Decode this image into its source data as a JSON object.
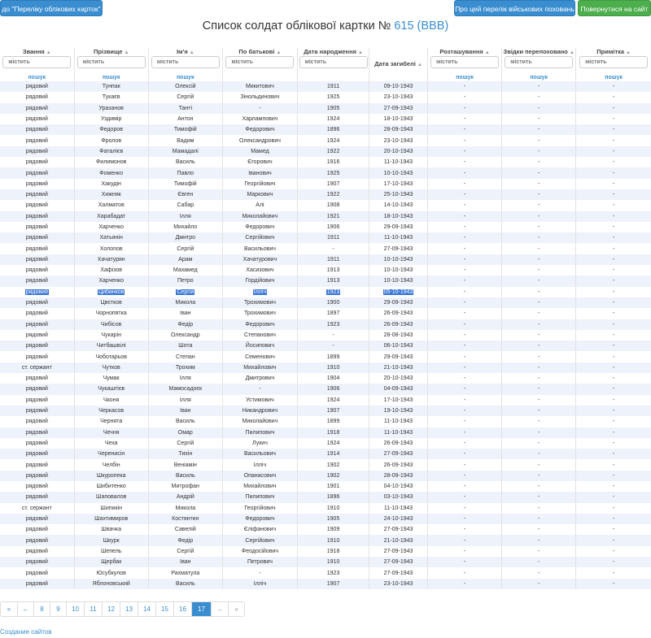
{
  "buttons": {
    "list": "до \"Переліку облікових карток\"",
    "about": "Про цей перелік військових поховань",
    "back": "Повернутися на сайт"
  },
  "title": {
    "text": "Список солдат облікової картки №",
    "number": "615 (ВВВ)"
  },
  "columns": [
    "Звання",
    "Прізвище",
    "Ім'я",
    "По батькові",
    "Дата народження",
    "Дата загибелі",
    "Розташування",
    "Звідки перепоховано",
    "Примітка"
  ],
  "filter_placeholder": "містить",
  "search_label": "пошук",
  "sort_icon": "sort-triangle-icon",
  "rows": [
    [
      "рядовий",
      "Тунпак",
      "Олексій",
      "Микитович",
      "1911",
      "09-10-1943",
      "-",
      "-",
      "-"
    ],
    [
      "рядовий",
      "Тукаєв",
      "Сергій",
      "Зінольдинович",
      "1925",
      "23-10-1943",
      "-",
      "-",
      "-"
    ],
    [
      "рядовий",
      "Уразанов",
      "Танті",
      "-",
      "1905",
      "27-09-1943",
      "-",
      "-",
      "-"
    ],
    [
      "рядовий",
      "Уздимір",
      "Антон",
      "Харлампович",
      "1924",
      "18-10-1943",
      "-",
      "-",
      "-"
    ],
    [
      "рядовий",
      "Федоров",
      "Тимофій",
      "Федорович",
      "1896",
      "28-09-1943",
      "-",
      "-",
      "-"
    ],
    [
      "рядовий",
      "Фролов",
      "Вадим",
      "Олександрович",
      "1924",
      "23-10-1943",
      "-",
      "-",
      "-"
    ],
    [
      "рядовий",
      "Фаталієв",
      "Мамадалі",
      "Мамед",
      "1922",
      "20-10-1943",
      "-",
      "-",
      "-"
    ],
    [
      "рядовий",
      "Филимонов",
      "Василь",
      "Єгорович",
      "1916",
      "11-10-1943",
      "-",
      "-",
      "-"
    ],
    [
      "рядовий",
      "Фоменко",
      "Павло",
      "Іванович",
      "1925",
      "10-10-1943",
      "-",
      "-",
      "-"
    ],
    [
      "рядовий",
      "Хакудін",
      "Тимофій",
      "Георгійович",
      "1907",
      "17-10-1943",
      "-",
      "-",
      "-"
    ],
    [
      "рядовий",
      "Хижняк",
      "Євген",
      "Маркович",
      "1922",
      "25-10-1943",
      "-",
      "-",
      "-"
    ],
    [
      "рядовий",
      "Халматов",
      "Сабар",
      "Алі",
      "1908",
      "14-10-1943",
      "-",
      "-",
      "-"
    ],
    [
      "рядовий",
      "Харабадат",
      "Ілля",
      "Миколайович",
      "1921",
      "18-10-1943",
      "-",
      "-",
      "-"
    ],
    [
      "рядовий",
      "Харченко",
      "Михайло",
      "Федорович",
      "1906",
      "29-09-1943",
      "-",
      "-",
      "-"
    ],
    [
      "рядовий",
      "Хатьянін",
      "Дмитро",
      "Сергійович",
      "1911",
      "11-10-1943",
      "-",
      "-",
      "-"
    ],
    [
      "рядовий",
      "Холопов",
      "Сергій",
      "Васильович",
      "-",
      "27-09-1943",
      "-",
      "-",
      "-"
    ],
    [
      "рядовий",
      "Хачатурян",
      "Арам",
      "Хачатурович",
      "1911",
      "10-10-1943",
      "-",
      "-",
      "-"
    ],
    [
      "рядовий",
      "Хафізов",
      "Махамед",
      "Хасизович",
      "1913",
      "10-10-1943",
      "-",
      "-",
      "-"
    ],
    [
      "рядовий",
      "Харченко",
      "Петро",
      "Гордійович",
      "1913",
      "10-10-1943",
      "-",
      "-",
      "-"
    ],
    [
      "рядовий",
      "Цибанков",
      "Сергій",
      "Ілліч",
      "1923",
      "05-10-1943",
      "-",
      "-",
      "-"
    ],
    [
      "рядовий",
      "Цвєтков",
      "Микола",
      "Трохимович",
      "1900",
      "29-09-1943",
      "-",
      "-",
      "-"
    ],
    [
      "рядовий",
      "Чорнопятка",
      "Іван",
      "Трохимович",
      "1897",
      "26-09-1943",
      "-",
      "-",
      "-"
    ],
    [
      "рядовий",
      "Чибісов",
      "Федір",
      "Федорович",
      "1923",
      "26-09-1943",
      "-",
      "-",
      "-"
    ],
    [
      "рядовий",
      "Чукарін",
      "Олександр",
      "Степанович",
      "-",
      "28-08-1943",
      "-",
      "-",
      "-"
    ],
    [
      "рядовий",
      "Читбашвілі",
      "Шота",
      "Йосипович",
      "-",
      "06-10-1943",
      "-",
      "-",
      "-"
    ],
    [
      "рядовий",
      "Чоботарьов",
      "Степан",
      "Семенович",
      "1899",
      "29-09-1943",
      "-",
      "-",
      "-"
    ],
    [
      "ст. сержант",
      "Чутков",
      "Трохим",
      "Михайлович",
      "1910",
      "21-10-1943",
      "-",
      "-",
      "-"
    ],
    [
      "рядовий",
      "Чумак",
      "Ілля",
      "Дмитрович",
      "1904",
      "20-10-1943",
      "-",
      "-",
      "-"
    ],
    [
      "рядовий",
      "Чукаштієв",
      "Мамосадоєк",
      "-",
      "1906",
      "04-09-1943",
      "-",
      "-",
      "-"
    ],
    [
      "рядовий",
      "Чконя",
      "Ілля",
      "Устимович",
      "1924",
      "17-10-1943",
      "-",
      "-",
      "-"
    ],
    [
      "рядовий",
      "Черкасов",
      "Іван",
      "Никандрович",
      "1907",
      "19-10-1943",
      "-",
      "-",
      "-"
    ],
    [
      "рядовий",
      "Чернята",
      "Василь",
      "Миколайович",
      "1899",
      "11-10-1943",
      "-",
      "-",
      "-"
    ],
    [
      "рядовий",
      "Чечня",
      "Омар",
      "Пилипович",
      "1918",
      "11-10-1943",
      "-",
      "-",
      "-"
    ],
    [
      "рядовий",
      "Чеха",
      "Сергій",
      "Лукич",
      "1924",
      "26-09-1943",
      "-",
      "-",
      "-"
    ],
    [
      "рядовий",
      "Черенисін",
      "Тихін",
      "Васильович",
      "1914",
      "27-09-1943",
      "-",
      "-",
      "-"
    ],
    [
      "рядовий",
      "Челбін",
      "Веніамін",
      "Ілліч",
      "1902",
      "26-09-1943",
      "-",
      "-",
      "-"
    ],
    [
      "рядовий",
      "Шкуропека",
      "Василь",
      "Опанасович",
      "1902",
      "28-09-1943",
      "-",
      "-",
      "-"
    ],
    [
      "рядовий",
      "Шибитенко",
      "Митрофан",
      "Михайлович",
      "1901",
      "04-10-1943",
      "-",
      "-",
      "-"
    ],
    [
      "рядовий",
      "Шаповалов",
      "Андрій",
      "Пилипович",
      "1896",
      "03-10-1943",
      "-",
      "-",
      "-"
    ],
    [
      "ст. сержант",
      "Шипикін",
      "Микола",
      "Георгійович",
      "1910",
      "11-10-1943",
      "-",
      "-",
      "-"
    ],
    [
      "рядовий",
      "Шахтимиров",
      "Костянтин",
      "Федорович",
      "1905",
      "24-10-1943",
      "-",
      "-",
      "-"
    ],
    [
      "рядовий",
      "Швачка",
      "Савелій",
      "Єліфанович",
      "1909",
      "27-09-1943",
      "-",
      "-",
      "-"
    ],
    [
      "рядовий",
      "Шкурк",
      "Федір",
      "Сергійович",
      "1910",
      "21-10-1943",
      "-",
      "-",
      "-"
    ],
    [
      "рядовий",
      "Шепель",
      "Сергій",
      "Феодосійович",
      "1918",
      "27-09-1943",
      "-",
      "-",
      "-"
    ],
    [
      "рядовий",
      "Щербак",
      "Іван",
      "Петрович",
      "1910",
      "27-09-1943",
      "-",
      "-",
      "-"
    ],
    [
      "рядовий",
      "Юсубкулов",
      "Рахматула",
      "-",
      "1923",
      "27-09-1943",
      "-",
      "-",
      "-"
    ],
    [
      "рядовий",
      "Яблоновський",
      "Василь",
      "Ілліч",
      "1907",
      "23-10-1943",
      "-",
      "-",
      "-"
    ]
  ],
  "selected_row": 19,
  "pager": [
    "«",
    "←",
    "8",
    "9",
    "10",
    "11",
    "12",
    "13",
    "14",
    "15",
    "16",
    "17",
    "→",
    "»"
  ],
  "pager_active": "17",
  "footer": "Создание сайтов"
}
